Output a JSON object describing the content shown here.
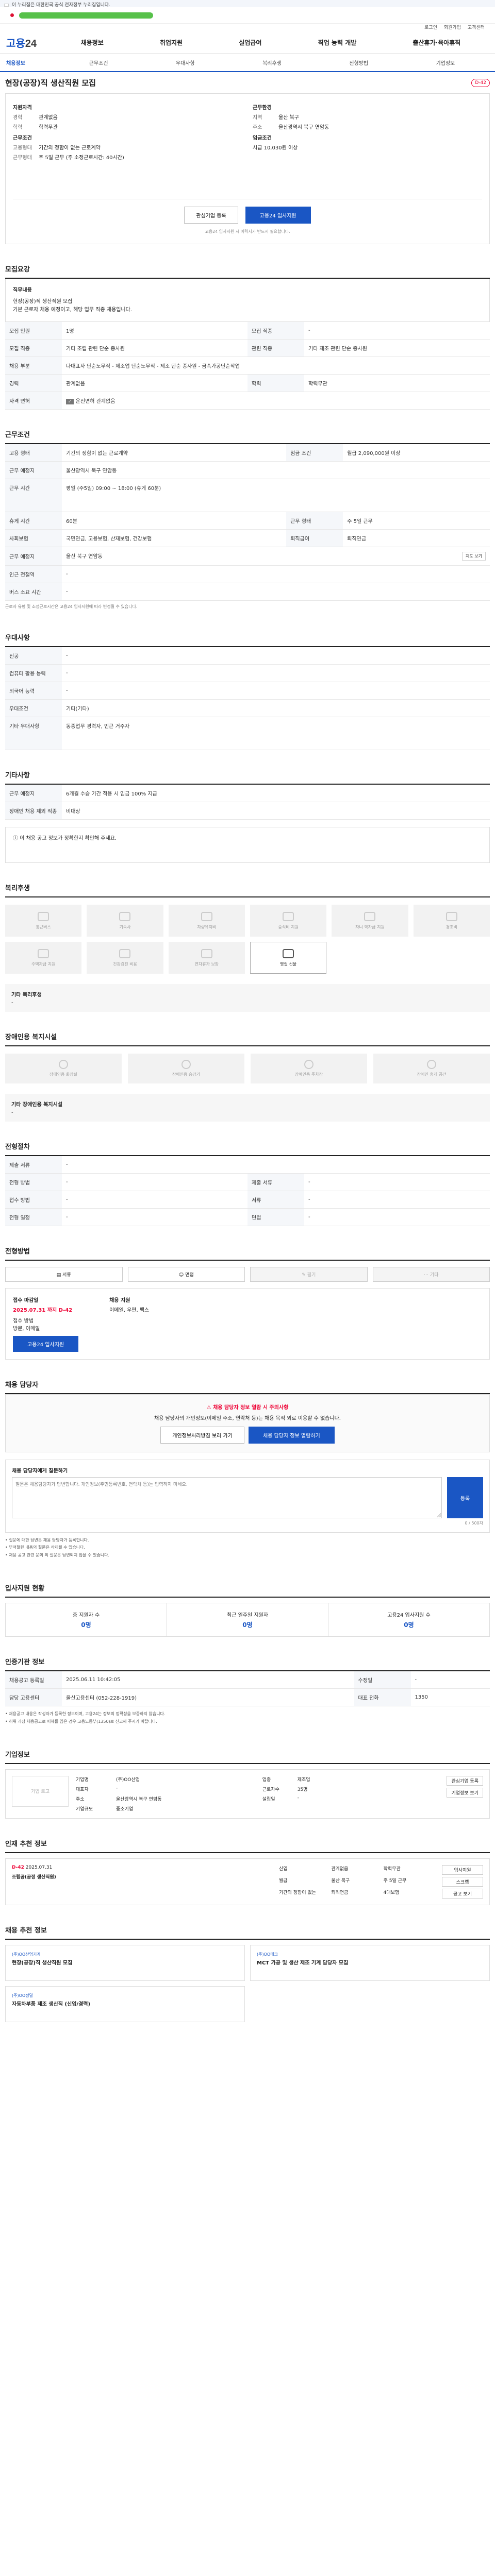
{
  "gov_notice": "이 누리집은 대한민국 공식 전자정부 누리집입니다.",
  "util_links": [
    "로그인",
    "회원가입",
    "고객센터"
  ],
  "logo": {
    "main": "고용",
    "num": "24"
  },
  "gnb": [
    "채용정보",
    "취업지원",
    "실업급여",
    "직업 능력 개발",
    "출산휴가·육아휴직"
  ],
  "lnb": {
    "current": "채용정보",
    "items": [
      "근무조건",
      "우대사항",
      "복리후생",
      "전형방법",
      "기업정보"
    ]
  },
  "job": {
    "title": "현장(공장)직 생산직원 모집",
    "dday": "D-42",
    "summary": {
      "left_title": "지원자격",
      "career_label": "경력",
      "career": "관계없음",
      "edu_label": "학력",
      "edu": "학력무관",
      "cond_title": "근무조건",
      "type_label": "고용형태",
      "type": "기간의 정함이 없는 근로계약",
      "time_label": "근무형태",
      "time": "주 5일 근무 (주 소정근로시간: 40시간)",
      "right_title": "근무환경",
      "region_label": "지역",
      "region": "울산 북구",
      "place_label": "주소",
      "place": "울산광역시 북구 연암동",
      "pay_label": "임금조건",
      "pay": "시급 10,030원 이상"
    },
    "btn_interest": "관심기업 등록",
    "btn_apply": "고용24 입사지원",
    "notice": "고용24 입사지원 시 이력서가 반드시 필요합니다."
  },
  "sec_job": {
    "title": "모집요강",
    "desc_title": "직무내용",
    "desc": [
      "현장(공장)직 생산직원 모집",
      "기본 근로자 채용 예정이고, 해당 업무 직종 채용입니다."
    ],
    "rows": [
      {
        "k": "모집 인원",
        "v": "1명",
        "k2": "모집 직종",
        "v2": "-"
      },
      {
        "k": "모집 직종",
        "v": "기타 조립 관련 단순 종사원",
        "k2": "관련 직종",
        "v2": "기타 제조 관련 단순 종사원"
      },
      {
        "k": "채용 부분",
        "v": "다대표자 단순노무직 - 제조업 단순노무직 - 제조 단순 종사원 - 금속가공단순작업",
        "k2": "",
        "v2": ""
      },
      {
        "k": "경력",
        "v": "관계없음",
        "k2": "학력",
        "v2": "학력무관"
      },
      {
        "k": "자격 면허",
        "v": "운전면허 관계없음",
        "k2": "",
        "v2": ""
      }
    ]
  },
  "sec_cond": {
    "title": "근무조건",
    "rows": [
      {
        "k": "고용 형태",
        "v": "기간의 정함이 없는 근로계약",
        "k2": "임금 조건",
        "v2": "월급 2,090,000원 이상"
      },
      {
        "k": "근무 예정지",
        "v": "울산광역시 북구 연암동",
        "k2": "",
        "v2": ""
      },
      {
        "k": "근무 시간",
        "v": "평일 (주5일) 09:00 ~ 18:00 (휴게 60분)",
        "k2": "",
        "v2": ""
      },
      {
        "k": "휴게 시간",
        "v": "60분",
        "k2": "근무 형태",
        "v2": "주 5일 근무"
      },
      {
        "k": "사회보험",
        "v": "국민연금, 고용보험, 산재보험, 건강보험",
        "k2": "퇴직급여",
        "v2": "퇴직연금"
      },
      {
        "k": "근무 예정지",
        "v": "울산 북구 연암동",
        "k2": "",
        "v2": "지도 보기"
      },
      {
        "k": "인근 전철역",
        "v": "-",
        "k2": "",
        "v2": ""
      },
      {
        "k": "버스 소요 시간",
        "v": "-",
        "k2": "",
        "v2": ""
      }
    ],
    "footnote": "근로자 유형 및 소정근로시간은 고용24 입사지원에 따라 변경될 수 있습니다."
  },
  "sec_pref": {
    "title": "우대사항",
    "rows": [
      {
        "k": "전공",
        "v": "-"
      },
      {
        "k": "컴퓨터 활용 능력",
        "v": "-"
      },
      {
        "k": "외국어 능력",
        "v": "-"
      },
      {
        "k": "우대조건",
        "v": "기타(기타)"
      },
      {
        "k": "기타 우대사항",
        "v": "동종업무 경력자, 인근 거주자"
      }
    ]
  },
  "sec_etc": {
    "title": "기타사항",
    "rows": [
      {
        "k": "근무 예정지",
        "v": "6개월 수습 기간 적용 시 임금 100% 지급"
      },
      {
        "k": "장애인 채용 제외 직종",
        "v": "비대상"
      }
    ],
    "dialog": "이 채용 공고 정보가 정확한지 확인해 주세요."
  },
  "sec_benefit": {
    "title": "복리후생",
    "items": [
      {
        "label": "통근버스",
        "on": false
      },
      {
        "label": "기숙사",
        "on": false
      },
      {
        "label": "차량유지비",
        "on": false
      },
      {
        "label": "중식비 지원",
        "on": false
      },
      {
        "label": "자녀 학자금 지원",
        "on": false
      },
      {
        "label": "경조비",
        "on": false
      },
      {
        "label": "주택자금 지원",
        "on": false
      },
      {
        "label": "건강검진 비용",
        "on": false
      },
      {
        "label": "연차휴가 보장",
        "on": false
      },
      {
        "label": "명절 선물",
        "on": true
      }
    ],
    "etc_title": "기타 복리후생",
    "etc": "-"
  },
  "sec_dis": {
    "title": "장애인용 복지시설",
    "items": [
      "장애인용 화장실",
      "장애인용 승강기",
      "장애인용 주차장",
      "장애인 휴게 공간"
    ],
    "etc_title": "기타 장애인용 복지시설",
    "etc": "-"
  },
  "sec_screen": {
    "title": "전형절차",
    "rows": [
      {
        "k": "제출 서류",
        "v": "-",
        "k2": "",
        "v2": ""
      },
      {
        "k": "전형 방법",
        "v": "-",
        "k2": "제출 서류",
        "v2": "-"
      },
      {
        "k": "접수 방법",
        "v": "-",
        "k2": "서류",
        "v2": "-"
      },
      {
        "k": "전형 일정",
        "v": "-",
        "k2": "면접",
        "v2": "-"
      }
    ]
  },
  "sec_apply": {
    "title": "전형방법",
    "methods": [
      {
        "label": "서류",
        "on": true
      },
      {
        "label": "면접",
        "on": true
      },
      {
        "label": "필기",
        "on": false
      },
      {
        "label": "기타",
        "on": false
      }
    ],
    "deadline_label": "접수 마감일",
    "deadline": "2025.07.31 까지 D-42",
    "method_label": "접수 방법",
    "method": "방문, 이메일",
    "contact_label": "채용 지원",
    "contact": "이메일, 우편, 팩스",
    "btn": "고용24 입사지원"
  },
  "sec_manager": {
    "title": "채용 담당자",
    "warn": "채용 담당자 정보 열람 시 주의사항",
    "desc": "채용 담당자의 개인정보(이메일 주소, 연락처 등)는 채용 목적 외로 이용할 수 없습니다.",
    "btn_a": "개인정보처리방침 보러 가기",
    "btn_b": "채용 담당자 정보 열람하기",
    "q_label": "채용 담당자에게 질문하기",
    "q_placeholder": "질문은 채용담당자가 답변합니다. 개인정보(주민등록번호, 연락처 등)는 입력하지 마세요.",
    "q_send": "등록",
    "q_counter": "0 / 500자",
    "bullets": [
      "• 질문에 대한 답변은 채용 담당자가 등록합니다.",
      "• 부적절한 내용의 질문은 삭제될 수 있습니다.",
      "• 채용 공고 관련 문의 외 질문은 답변되지 않을 수 있습니다."
    ]
  },
  "sec_stats": {
    "title": "입사지원 현황",
    "items": [
      {
        "label": "총 지원자 수",
        "value": "0명"
      },
      {
        "label": "최근 일주일 지원자",
        "value": "0명"
      },
      {
        "label": "고용24 입사지원 수",
        "value": "0명"
      }
    ]
  },
  "sec_info": {
    "title": "인증기관 정보",
    "rows": [
      {
        "k": "채용공고 등록일",
        "v": "2025.06.11 10:42:05",
        "k2": "수정일",
        "v2": "-"
      },
      {
        "k": "담당 고용센터",
        "v": "울산고용센터 (052-228-1919)",
        "k2": "대표 전화",
        "v2": "1350"
      }
    ],
    "bullets": [
      "• 채용공고 내용은 작성자가 등록한 정보이며, 고용24는 정보의 정확성을 보증하지 않습니다.",
      "• 허위 과장 채용공고로 피해를 입은 경우 고용노동부(1350)로 신고해 주시기 바랍니다."
    ]
  },
  "sec_company": {
    "title": "기업정보",
    "logo_alt": "기업 로고",
    "meta": [
      {
        "k": "기업명",
        "v": "(주)OO산업",
        "k2": "업종",
        "v2": "제조업"
      },
      {
        "k": "대표자",
        "v": "-",
        "k2": "근로자수",
        "v2": "35명"
      },
      {
        "k": "주소",
        "v": "울산광역시 북구 연암동",
        "k2": "설립일",
        "v2": "-"
      },
      {
        "k": "기업규모",
        "v": "중소기업",
        "k2": "",
        "v2": ""
      }
    ],
    "acts": [
      "관심기업 등록",
      "기업정보 보기"
    ]
  },
  "sec_other": {
    "title": "인재 추천 정보",
    "job": {
      "dday": "D-42",
      "date": "2025.07.31",
      "title": "조립공(공정 생산직원)"
    },
    "tags": [
      "신입",
      "관계없음",
      "학력무관",
      "월급",
      "울산 북구",
      "주 5일 근무",
      "기간의 정함이 없는",
      "퇴직연금",
      "4대보험"
    ],
    "side": [
      "입사지원",
      "스크랩",
      "공고 보기"
    ]
  },
  "sec_cards": {
    "title": "채용 추천 정보",
    "cards": [
      {
        "comp": "(주)OO산업기계",
        "title": "현장(공장)직 생산직원 모집"
      },
      {
        "comp": "(주)OO테크",
        "title": "MCT 가공 및 생산 제조 기계 담당자 모집"
      },
      {
        "comp": "(주)OO정밀",
        "title": "자동차부품 제조 생산직 (신입/경력)"
      }
    ]
  }
}
